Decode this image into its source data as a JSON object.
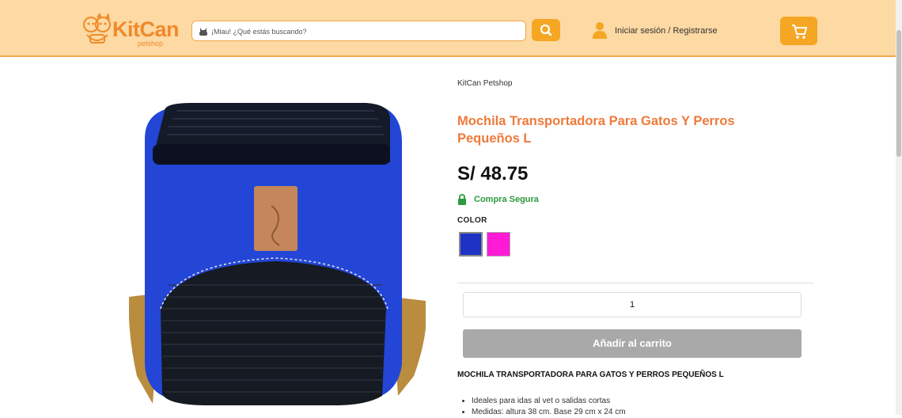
{
  "header": {
    "brand": "KitCan",
    "brand_sub": "petshop",
    "search_placeholder": "¡Miau! ¿Qué estás buscando?",
    "login_label": "Iniciar sesión / Registrarse",
    "icons": [
      "pet-faces-logo",
      "cat-icon",
      "search-icon",
      "user-icon",
      "cart-icon"
    ]
  },
  "product": {
    "breadcrumb": "KitCan Petshop",
    "title": "Mochila Transportadora Para Gatos Y Perros Pequeños L",
    "price": "S/ 48.75",
    "secure_label": "Compra Segura",
    "color_label": "COLOR",
    "colors": [
      {
        "name": "blue",
        "hex": "#1e33c5"
      },
      {
        "name": "pink",
        "hex": "#ff1bd6"
      }
    ],
    "quantity": "1",
    "add_to_cart": "Añadir al carrito",
    "description_title": "MOCHILA TRANSPORTADORA PARA GATOS Y PERROS PEQUEÑOS L",
    "description_items": [
      "Ideales para idas al vet o salidas cortas",
      "Medidas: altura 38 cm. Base 29 cm x 24 cm"
    ]
  },
  "colors": {
    "header_bg": "#fdd9a3",
    "accent": "#f5a623",
    "title": "#ee7a3a",
    "secure": "#2c9a3e",
    "button_disabled": "#a9a9a9"
  }
}
